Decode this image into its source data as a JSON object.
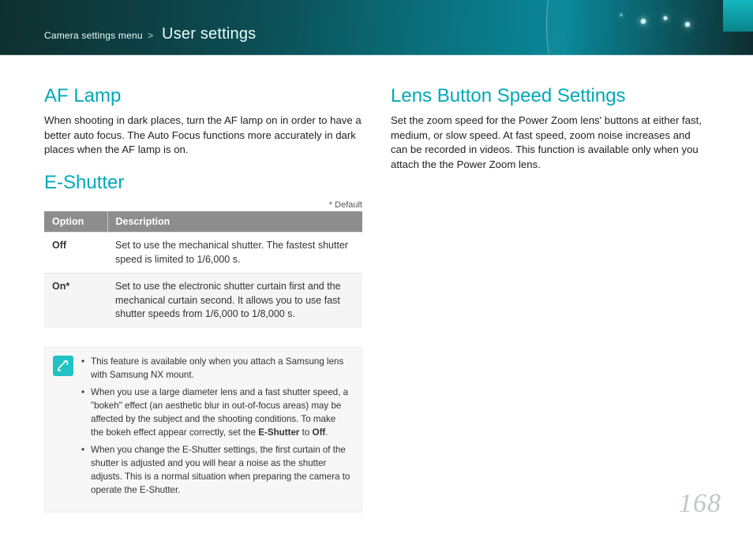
{
  "header": {
    "breadcrumb_parent": "Camera settings menu",
    "breadcrumb_sep": ">",
    "title": "User settings"
  },
  "page_number": "168",
  "left": {
    "af_lamp": {
      "heading": "AF Lamp",
      "body": "When shooting in dark places, turn the AF lamp on in order to have a better auto focus. The Auto Focus functions more accurately in dark places when the AF lamp is on."
    },
    "eshutter": {
      "heading": "E-Shutter",
      "default_note": "* Default",
      "table": {
        "col_option": "Option",
        "col_description": "Description",
        "rows": [
          {
            "option": "Off",
            "description": "Set to use the mechanical shutter. The fastest shutter speed is limited to 1/6,000 s."
          },
          {
            "option": "On*",
            "description": "Set to use the electronic shutter curtain first and the mechanical curtain second. It allows you to use fast shutter speeds from 1/6,000 to 1/8,000 s."
          }
        ]
      },
      "notes": {
        "item1": "This feature is available only when you attach a Samsung lens with Samsung NX mount.",
        "item2_pre": "When you use a large diameter lens and a fast shutter speed, a \"bokeh\" effect (an aesthetic blur in out-of-focus areas) may be affected by the subject and the shooting conditions. To make the bokeh effect appear correctly, set the ",
        "item2_bold1": "E-Shutter",
        "item2_mid": " to ",
        "item2_bold2": "Off",
        "item2_post": ".",
        "item3": "When you change the E-Shutter settings, the first curtain of the shutter is adjusted and you will hear a noise as the shutter adjusts. This is a normal situation when preparing the camera to operate the E-Shutter."
      }
    }
  },
  "right": {
    "lens_button": {
      "heading": "Lens Button Speed Settings",
      "body": "Set the zoom speed for the Power Zoom lens' buttons at either fast, medium, or slow speed. At fast speed, zoom noise increases and can be recorded in videos. This function is available only when you attach the the Power Zoom lens."
    }
  }
}
